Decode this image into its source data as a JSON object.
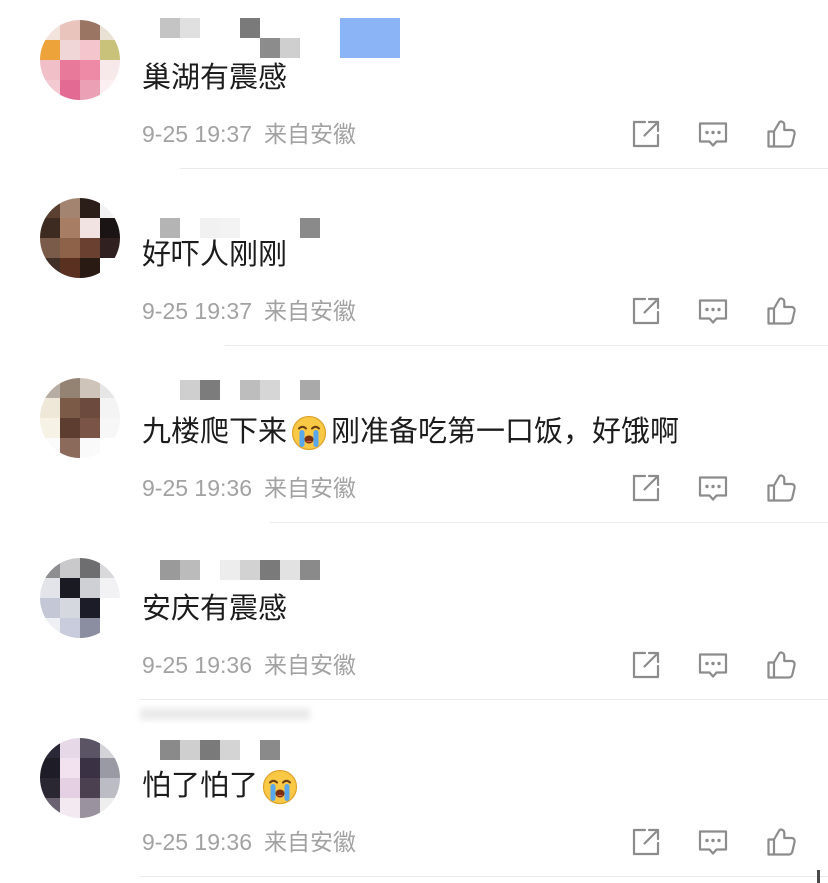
{
  "colors": {
    "background": "#ffffff",
    "text": "#1c1c1c",
    "meta": "#a2a2a2",
    "icon": "#8c8c8c",
    "divider": "#ebebeb"
  },
  "icons": {
    "share": "share-icon",
    "comment": "comment-icon",
    "like": "like-icon",
    "emoji": "crying-face-icon"
  },
  "comments": [
    {
      "parts": [
        {
          "text": "巢湖有震感"
        }
      ],
      "time": "9-25 19:37",
      "source": "来自安徽"
    },
    {
      "parts": [
        {
          "text": "好吓人刚刚"
        }
      ],
      "time": "9-25 19:37",
      "source": "来自安徽"
    },
    {
      "parts": [
        {
          "text": "九楼爬下来"
        },
        {
          "emoji": "crying-face"
        },
        {
          "text": "刚准备吃第一口饭，好饿啊"
        }
      ],
      "time": "9-25 19:36",
      "source": "来自安徽"
    },
    {
      "parts": [
        {
          "text": "安庆有震感"
        }
      ],
      "time": "9-25 19:36",
      "source": "来自安徽"
    },
    {
      "parts": [
        {
          "text": "怕了怕了"
        },
        {
          "emoji": "crying-face"
        }
      ],
      "time": "9-25 19:36",
      "source": "来自安徽"
    }
  ]
}
